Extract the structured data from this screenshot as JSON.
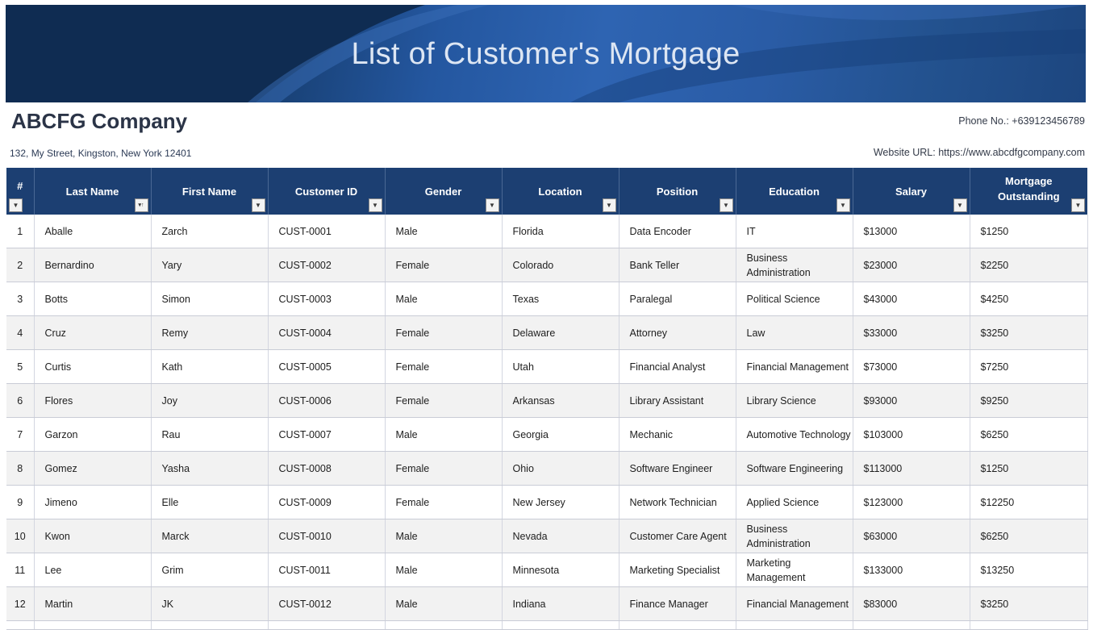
{
  "banner": {
    "title": "List of Customer's Mortgage"
  },
  "company": {
    "name": "ABCFG Company",
    "phone": "Phone No.: +639123456789",
    "address": "132, My Street, Kingston, New York 12401",
    "website": "Website URL: https://www.abcdfgcompany.com"
  },
  "table": {
    "headers": [
      "#",
      "Last Name",
      "First Name",
      "Customer ID",
      "Gender",
      "Location",
      "Position",
      "Education",
      "Salary",
      "Mortgage Outstanding"
    ],
    "rows": [
      [
        "1",
        "Aballe",
        "Zarch",
        "CUST-0001",
        "Male",
        "Florida",
        "Data Encoder",
        "IT",
        "$13000",
        "$1250"
      ],
      [
        "2",
        "Bernardino",
        "Yary",
        "CUST-0002",
        "Female",
        "Colorado",
        "Bank Teller",
        "Business Administration",
        "$23000",
        "$2250"
      ],
      [
        "3",
        "Botts",
        "Simon",
        "CUST-0003",
        "Male",
        "Texas",
        "Paralegal",
        "Political Science",
        "$43000",
        "$4250"
      ],
      [
        "4",
        "Cruz",
        "Remy",
        "CUST-0004",
        "Female",
        "Delaware",
        "Attorney",
        "Law",
        "$33000",
        "$3250"
      ],
      [
        "5",
        "Curtis",
        "Kath",
        "CUST-0005",
        "Female",
        "Utah",
        "Financial Analyst",
        "Financial Management",
        "$73000",
        "$7250"
      ],
      [
        "6",
        "Flores",
        "Joy",
        "CUST-0006",
        "Female",
        "Arkansas",
        "Library Assistant",
        "Library Science",
        "$93000",
        "$9250"
      ],
      [
        "7",
        "Garzon",
        "Rau",
        "CUST-0007",
        "Male",
        "Georgia",
        "Mechanic",
        "Automotive Technology",
        "$103000",
        "$6250"
      ],
      [
        "8",
        "Gomez",
        "Yasha",
        "CUST-0008",
        "Female",
        "Ohio",
        "Software Engineer",
        "Software Engineering",
        "$113000",
        "$1250"
      ],
      [
        "9",
        "Jimeno",
        "Elle",
        "CUST-0009",
        "Female",
        "New Jersey",
        "Network Technician",
        "Applied Science",
        "$123000",
        "$12250"
      ],
      [
        "10",
        "Kwon",
        "Marck",
        "CUST-0010",
        "Male",
        "Nevada",
        "Customer Care Agent",
        "Business Administration",
        "$63000",
        "$6250"
      ],
      [
        "11",
        "Lee",
        "Grim",
        "CUST-0011",
        "Male",
        "Minnesota",
        "Marketing Specialist",
        "Marketing Management",
        "$133000",
        "$13250"
      ],
      [
        "12",
        "Martin",
        "JK",
        "CUST-0012",
        "Male",
        "Indiana",
        "Finance Manager",
        "Financial Management",
        "$83000",
        "$3250"
      ]
    ]
  },
  "icons": {
    "filter": "filter-dropdown-icon",
    "sort": "sort-ascending-filter-icon"
  }
}
